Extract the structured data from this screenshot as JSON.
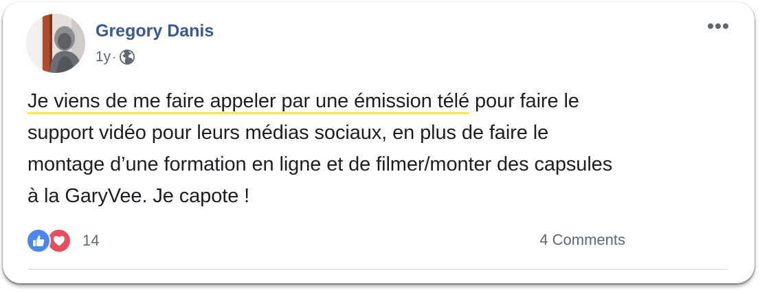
{
  "post": {
    "author": "Gregory Danis",
    "time": "1y",
    "separator": "·",
    "text_highlighted": "Je viens de me faire appeler par une émission télé",
    "text_line1_rest": " pour faire le",
    "text_line2": "support vidéo pour leurs médias sociaux, en plus de faire le",
    "text_line3": "montage d’une formation en ligne et de filmer/monter des capsules",
    "text_line4": "à la GaryVee. Je capote !"
  },
  "footer": {
    "reaction_count": "14",
    "comments": "4 Comments"
  },
  "icons": {
    "avatar": "profile-photo",
    "privacy": "globe-icon",
    "menu": "more-options-icon",
    "reaction_1": "like-icon",
    "reaction_2": "love-icon"
  },
  "colors": {
    "author": "#385898",
    "highlight": "#f7ec3a",
    "like": "#4a87f0",
    "love": "#eb4d5c",
    "meta": "#606770"
  }
}
